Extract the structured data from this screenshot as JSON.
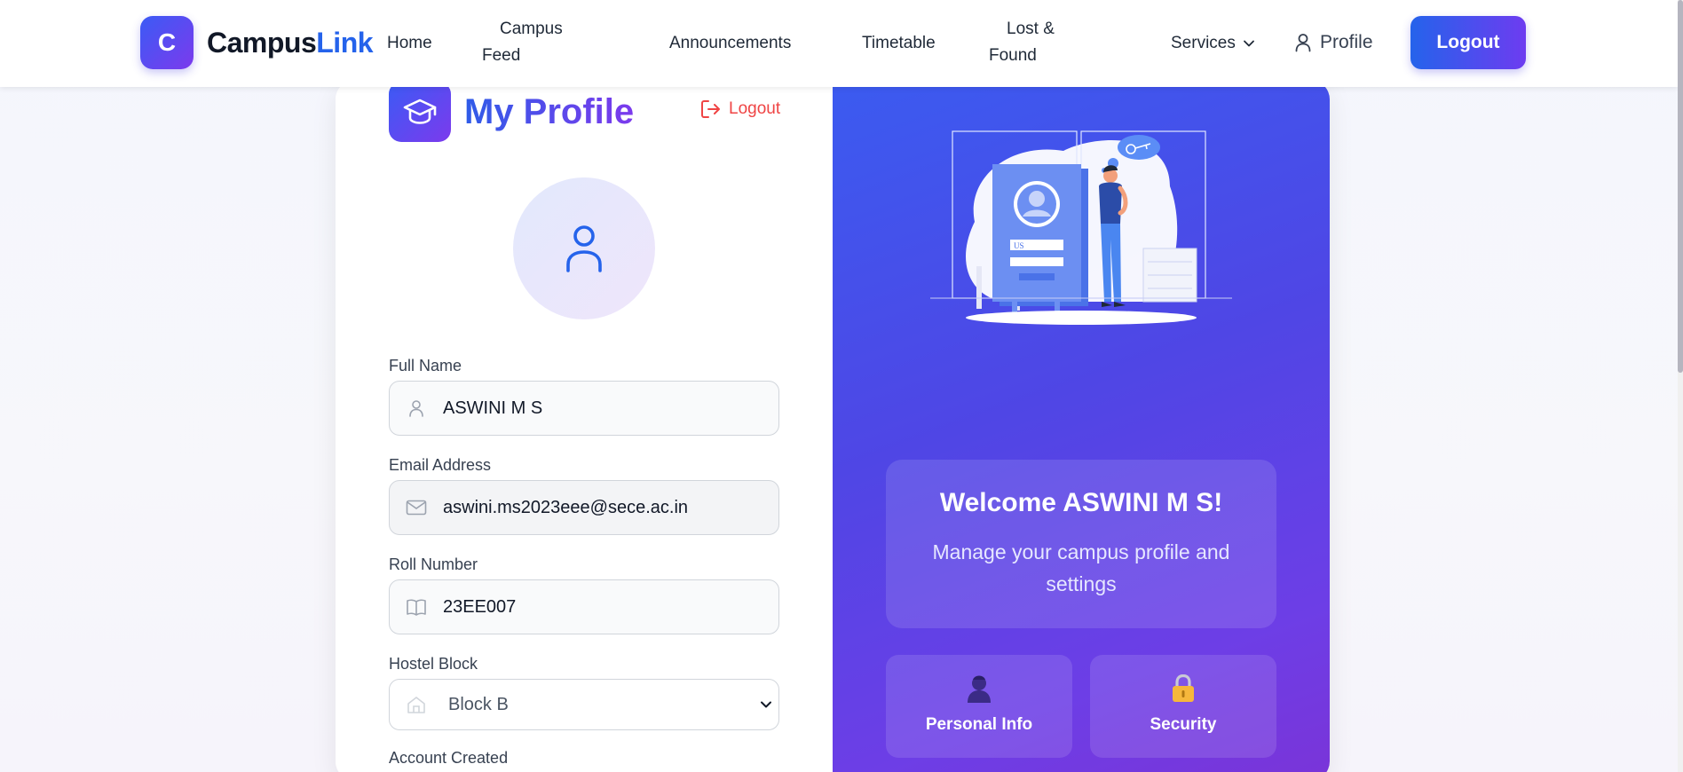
{
  "navbar": {
    "logo_letter": "C",
    "brand_part1": "Campus",
    "brand_part2": "Link",
    "links": {
      "home": "Home",
      "campus_feed_line1": "Campus",
      "campus_feed_line2": "Feed",
      "announcements": "Announcements",
      "timetable": "Timetable",
      "lost_found_line1": "Lost &",
      "lost_found_line2": "Found",
      "services": "Services",
      "profile": "Profile"
    },
    "logout_label": "Logout"
  },
  "profile": {
    "title": "My Profile",
    "logout_link": "Logout",
    "fields": {
      "full_name_label": "Full Name",
      "full_name_value": "ASWINI M S",
      "email_label": "Email Address",
      "email_value": "aswini.ms2023eee@sece.ac.in",
      "roll_label": "Roll Number",
      "roll_value": "23EE007",
      "hostel_label": "Hostel Block",
      "hostel_value": "Block B",
      "account_created_label": "Account Created"
    }
  },
  "welcome_panel": {
    "title": "Welcome ASWINI M S!",
    "subtitle": "Manage your campus profile and settings",
    "cards": [
      {
        "label": "Personal Info",
        "icon": "person-silhouette-icon"
      },
      {
        "label": "Security",
        "icon": "padlock-icon"
      }
    ],
    "illustration_badge": "US"
  },
  "colors": {
    "primary_blue": "#2563eb",
    "primary_purple": "#7c3aed",
    "danger": "#ef4444"
  }
}
